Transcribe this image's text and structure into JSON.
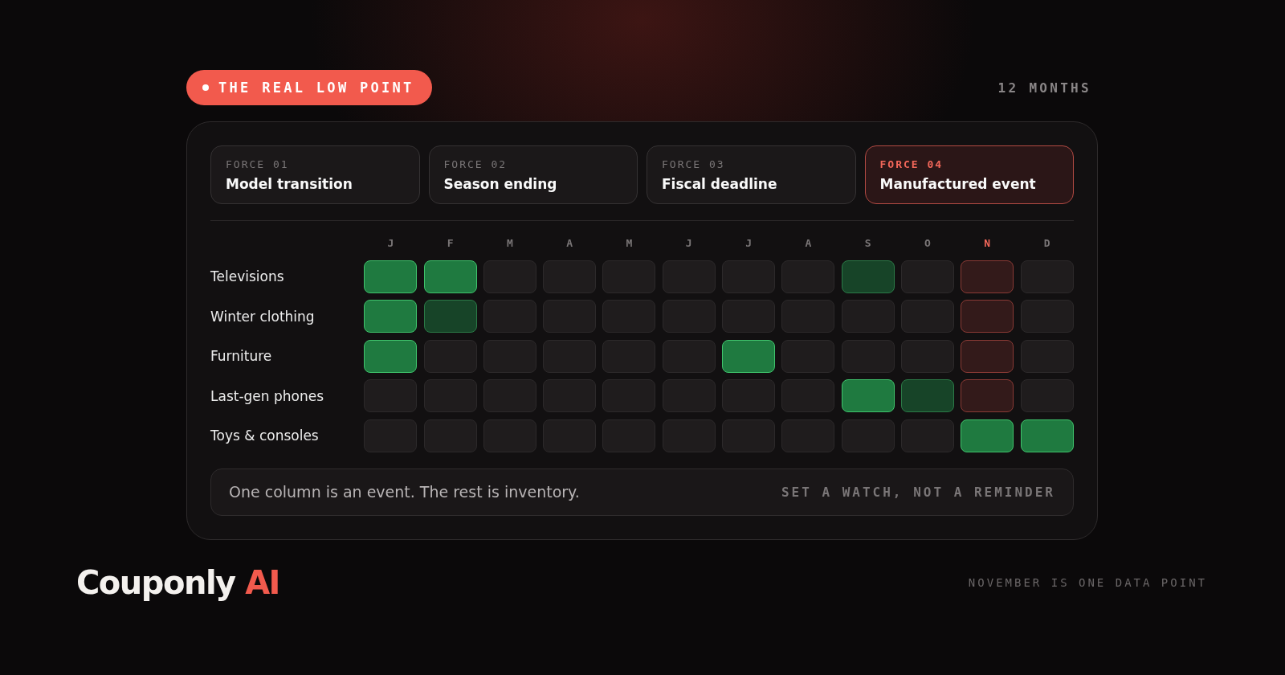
{
  "badge": {
    "label": "THE REAL LOW POINT"
  },
  "period": "12 MONTHS",
  "forces": [
    {
      "number": "FORCE 01",
      "title": "Model transition",
      "selected": false
    },
    {
      "number": "FORCE 02",
      "title": "Season ending",
      "selected": false
    },
    {
      "number": "FORCE 03",
      "title": "Fiscal deadline",
      "selected": false
    },
    {
      "number": "FORCE 04",
      "title": "Manufactured event",
      "selected": true
    }
  ],
  "months": [
    {
      "label": "J",
      "highlighted": false
    },
    {
      "label": "F",
      "highlighted": false
    },
    {
      "label": "M",
      "highlighted": false
    },
    {
      "label": "A",
      "highlighted": false
    },
    {
      "label": "M",
      "highlighted": false
    },
    {
      "label": "J",
      "highlighted": false
    },
    {
      "label": "J",
      "highlighted": false
    },
    {
      "label": "A",
      "highlighted": false
    },
    {
      "label": "S",
      "highlighted": false
    },
    {
      "label": "O",
      "highlighted": false
    },
    {
      "label": "N",
      "highlighted": true
    },
    {
      "label": "D",
      "highlighted": false
    }
  ],
  "rows": [
    {
      "category": "Televisions",
      "cells": [
        {
          "kind": "strong"
        },
        {
          "kind": "strong"
        },
        {
          "kind": "none"
        },
        {
          "kind": "none"
        },
        {
          "kind": "none"
        },
        {
          "kind": "none"
        },
        {
          "kind": "none"
        },
        {
          "kind": "none"
        },
        {
          "kind": "mild"
        },
        {
          "kind": "none"
        },
        {
          "kind": "event"
        },
        {
          "kind": "none"
        }
      ]
    },
    {
      "category": "Winter clothing",
      "cells": [
        {
          "kind": "strong"
        },
        {
          "kind": "mild"
        },
        {
          "kind": "none"
        },
        {
          "kind": "none"
        },
        {
          "kind": "none"
        },
        {
          "kind": "none"
        },
        {
          "kind": "none"
        },
        {
          "kind": "none"
        },
        {
          "kind": "none"
        },
        {
          "kind": "none"
        },
        {
          "kind": "event"
        },
        {
          "kind": "none"
        }
      ]
    },
    {
      "category": "Furniture",
      "cells": [
        {
          "kind": "strong"
        },
        {
          "kind": "none"
        },
        {
          "kind": "none"
        },
        {
          "kind": "none"
        },
        {
          "kind": "none"
        },
        {
          "kind": "none"
        },
        {
          "kind": "strong"
        },
        {
          "kind": "none"
        },
        {
          "kind": "none"
        },
        {
          "kind": "none"
        },
        {
          "kind": "event"
        },
        {
          "kind": "none"
        }
      ]
    },
    {
      "category": "Last-gen phones",
      "cells": [
        {
          "kind": "none"
        },
        {
          "kind": "none"
        },
        {
          "kind": "none"
        },
        {
          "kind": "none"
        },
        {
          "kind": "none"
        },
        {
          "kind": "none"
        },
        {
          "kind": "none"
        },
        {
          "kind": "none"
        },
        {
          "kind": "strong"
        },
        {
          "kind": "mild"
        },
        {
          "kind": "event"
        },
        {
          "kind": "none"
        }
      ]
    },
    {
      "category": "Toys & consoles",
      "cells": [
        {
          "kind": "none"
        },
        {
          "kind": "none"
        },
        {
          "kind": "none"
        },
        {
          "kind": "none"
        },
        {
          "kind": "none"
        },
        {
          "kind": "none"
        },
        {
          "kind": "none"
        },
        {
          "kind": "none"
        },
        {
          "kind": "none"
        },
        {
          "kind": "none"
        },
        {
          "kind": "strong"
        },
        {
          "kind": "strong"
        }
      ]
    }
  ],
  "footer_note": {
    "text": "One column is an event. The rest is inventory.",
    "tagline": "SET A WATCH, NOT A REMINDER"
  },
  "brand": {
    "name": "Couponly",
    "suffix": "AI"
  },
  "caption": "NOVEMBER IS ONE DATA POINT"
}
